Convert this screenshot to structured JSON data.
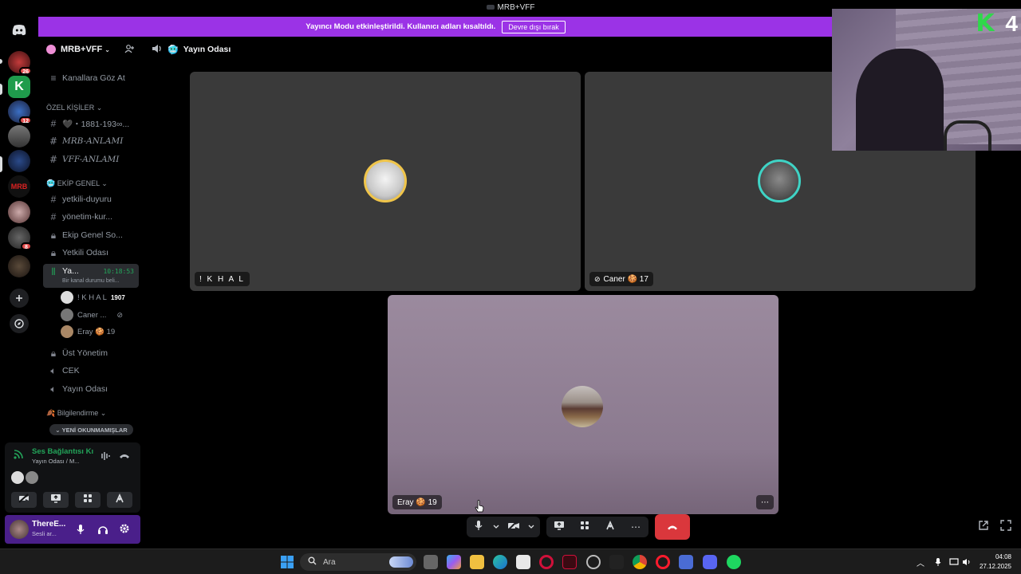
{
  "window": {
    "title": "MRB+VFF"
  },
  "banner": {
    "message": "Yayıncı Modu etkinleştirildi. Kullanıcı adları kısaltıldı.",
    "button": "Devre dışı bırak"
  },
  "rail": {
    "badges": [
      "26",
      "12",
      "8"
    ]
  },
  "guild": {
    "name": "MRB+VFF"
  },
  "sidebar": {
    "browse": "Kanallara Göz At",
    "categories": {
      "private": "ÖZEL KİŞİLER",
      "team": "EKİP GENEL",
      "info": "Bilgilendirme"
    },
    "channels": {
      "c1": "🖤・1881-193∞...",
      "c2": "MRB-ANLAMI",
      "c3": "VFF-ANLAMI",
      "c4": "yetkili-duyuru",
      "c5": "yönetim-kur...",
      "c6": "Ekip Genel So...",
      "c7": "Yetkili Odası",
      "c8": "Ya...",
      "c8_time": "10:18:53",
      "c8_status": "Bir kanal durumu beli...",
      "c9": "Üst Yönetim",
      "c10": "CEK",
      "c11": "Yayın Odası"
    },
    "voice_members": {
      "m1": "! K H A L",
      "m1_badge": "1907",
      "m2": "Caner ...",
      "m3": "Eray 🍪 19"
    },
    "unread": "YENİ OKUNMAMIŞLAR"
  },
  "voice_panel": {
    "status": "Ses Bağlantısı Kı",
    "channel": "Yayın Odası / M..."
  },
  "user_panel": {
    "name": "ThereE...",
    "status": "Sesli ar..."
  },
  "stage": {
    "channel_name": "Yayın Odası",
    "tiles": {
      "t1": "! K H A L",
      "t2": "Caner 🍪 17",
      "t3": "Eray 🍪 19"
    }
  },
  "webcam": {
    "overlay_number": "4",
    "overlay_letter": "K"
  },
  "taskbar": {
    "search_placeholder": "Ara",
    "time": "04:08",
    "date": "27.12.2025"
  },
  "colors": {
    "banner": "#9b33e6",
    "hangup": "#da373c",
    "connected": "#23a55a",
    "user_panel": "#4a1f8a"
  }
}
